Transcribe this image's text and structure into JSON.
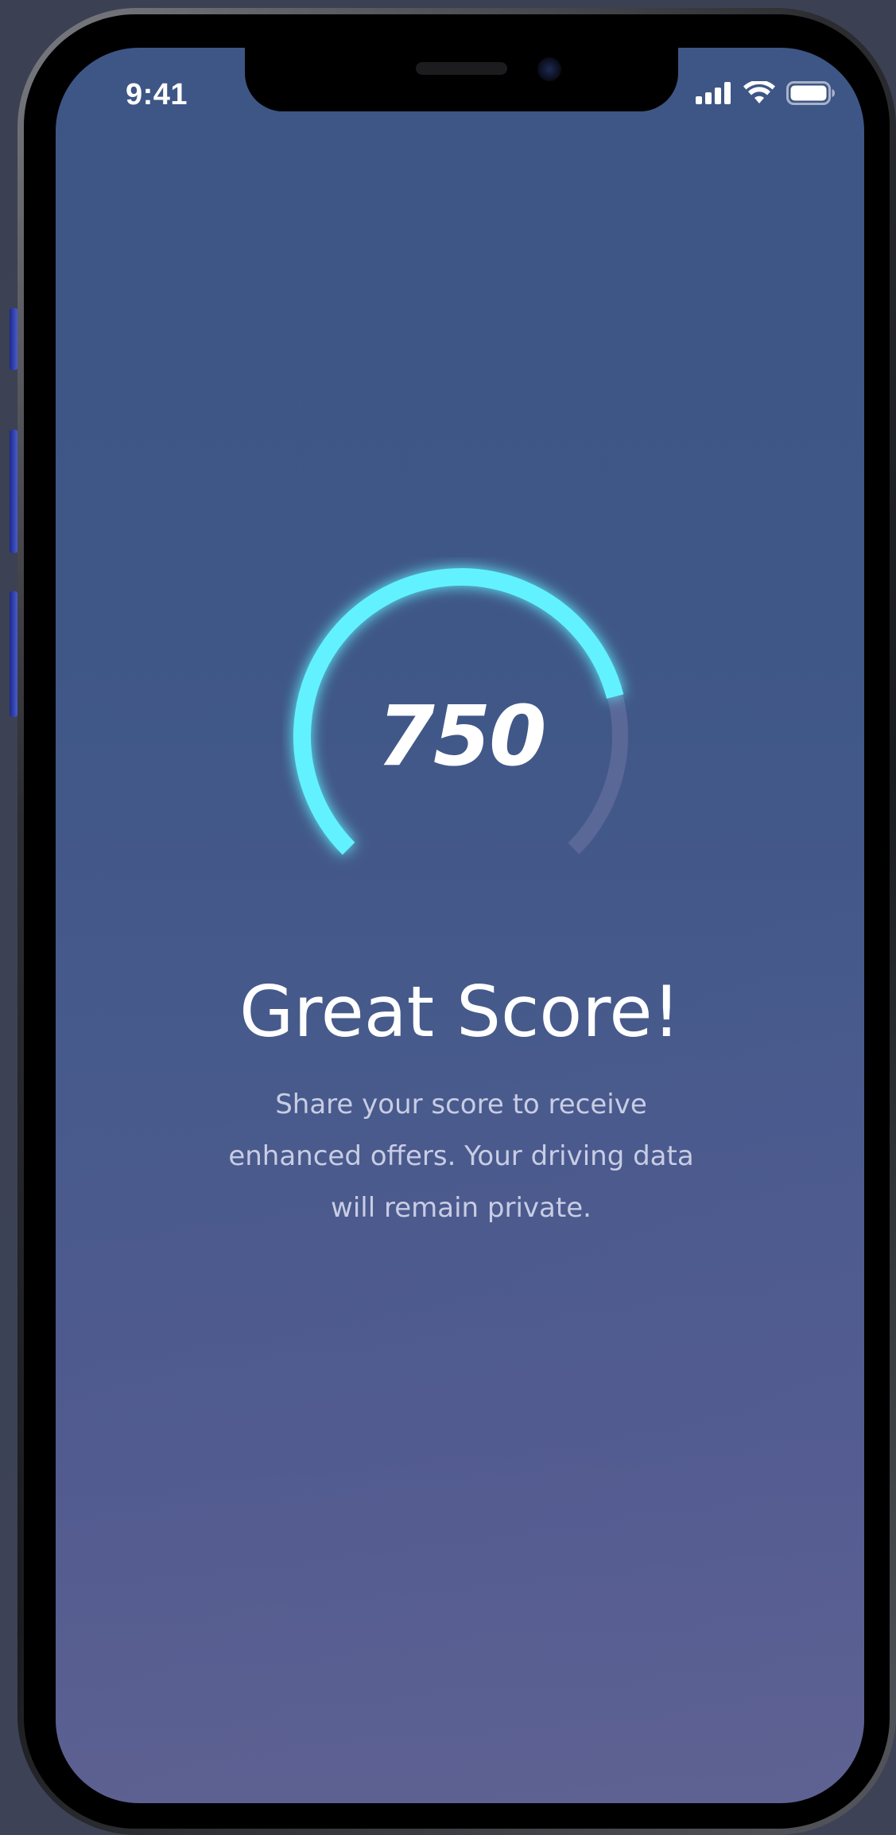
{
  "status_bar": {
    "time": "9:41",
    "signal_icon": "cellular-signal-icon",
    "wifi_icon": "wifi-icon",
    "battery_icon": "battery-icon"
  },
  "score": {
    "value": "750",
    "fraction": 0.78,
    "accent_color": "#62f2ff",
    "track_color": "#5a6898"
  },
  "headline": "Great Score!",
  "body_lines": [
    "Share your score to receive",
    "enhanced offers. Your driving data",
    "will remain private."
  ]
}
